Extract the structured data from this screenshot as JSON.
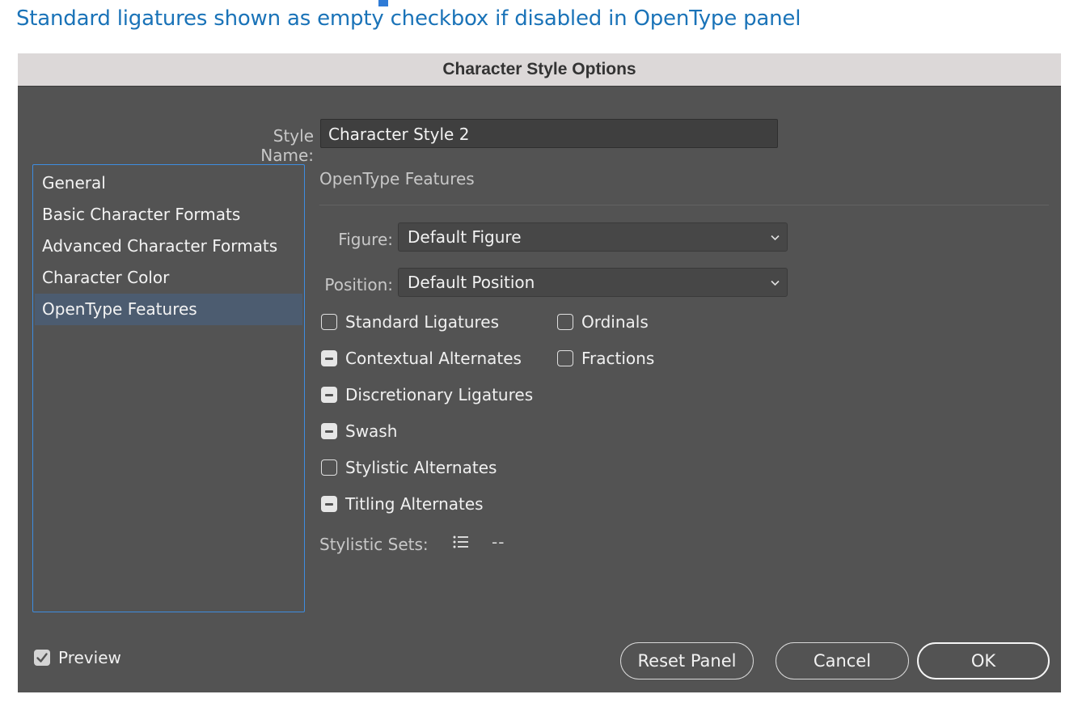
{
  "caption": "Standard ligatures shown as empty checkbox if disabled in OpenType panel",
  "dialog": {
    "title": "Character Style Options",
    "style_name_label": "Style Name:",
    "style_name_value": "Character Style 2"
  },
  "sidebar": {
    "items": [
      {
        "label": "General",
        "selected": false
      },
      {
        "label": "Basic Character Formats",
        "selected": false
      },
      {
        "label": "Advanced Character Formats",
        "selected": false
      },
      {
        "label": "Character Color",
        "selected": false
      },
      {
        "label": "OpenType Features",
        "selected": true
      }
    ]
  },
  "panel": {
    "section_title": "OpenType Features",
    "figure": {
      "label": "Figure:",
      "value": "Default Figure"
    },
    "position": {
      "label": "Position:",
      "value": "Default Position"
    },
    "checkboxes": [
      {
        "label": "Standard Ligatures",
        "state": "unchecked"
      },
      {
        "label": "Ordinals",
        "state": "unchecked"
      },
      {
        "label": "Contextual Alternates",
        "state": "mixed"
      },
      {
        "label": "Fractions",
        "state": "unchecked"
      },
      {
        "label": "Discretionary Ligatures",
        "state": "mixed"
      },
      {
        "label": "Swash",
        "state": "mixed"
      },
      {
        "label": "Stylistic Alternates",
        "state": "unchecked"
      },
      {
        "label": "Titling Alternates",
        "state": "mixed"
      }
    ],
    "stylistic_sets": {
      "label": "Stylistic Sets:",
      "value": "--",
      "icon": "list-icon"
    }
  },
  "footer": {
    "preview_label": "Preview",
    "preview_checked": true,
    "buttons": {
      "reset": "Reset Panel",
      "cancel": "Cancel",
      "ok": "OK"
    }
  },
  "colors": {
    "caption": "#1a73b8",
    "dialog_bg": "#535353",
    "titlebar_bg": "#dcd8d8",
    "sidebar_border": "#3e8de0",
    "selected_item_bg": "#4c5c70"
  }
}
